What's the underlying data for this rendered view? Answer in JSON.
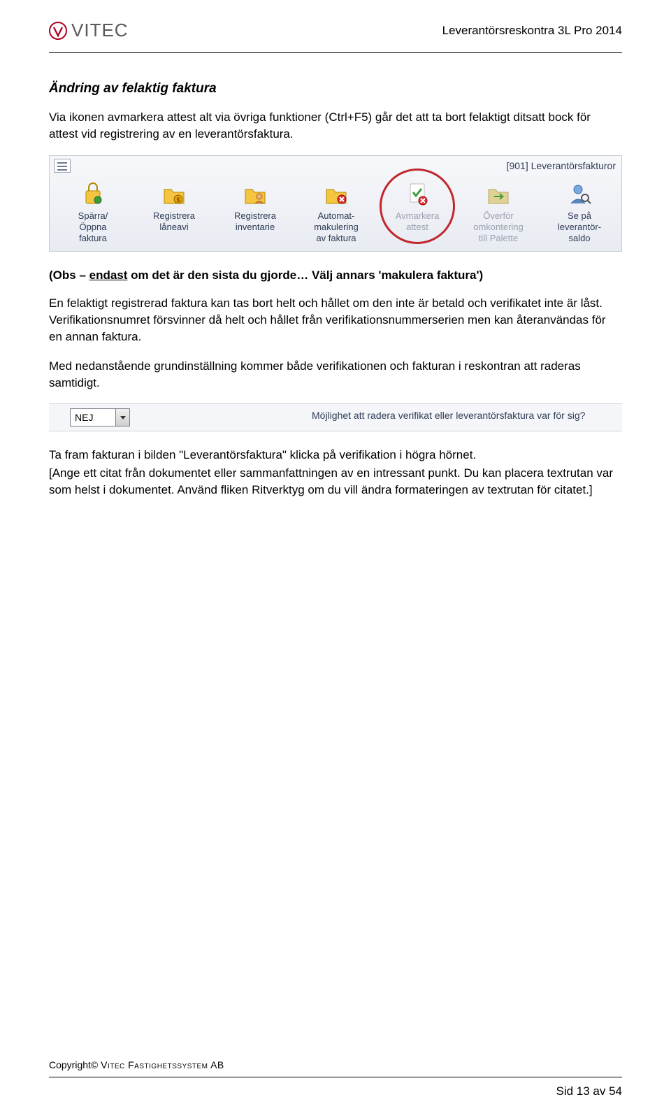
{
  "header": {
    "brand": "VITEC",
    "doc_title": "Leverantörsreskontra 3L Pro 2014"
  },
  "section_title": "Ändring av felaktig faktura",
  "para1": "Via ikonen avmarkera attest alt via övriga funktioner (Ctrl+F5) går det att ta bort felaktigt ditsatt bock för attest vid registrering av en leverantörsfaktura.",
  "toolbar": {
    "window_title": "[901]  Leverantörsfakturor",
    "items": [
      {
        "name": "lock-icon",
        "label_l1": "Spärra/",
        "label_l2": "Öppna",
        "label_l3": "faktura"
      },
      {
        "name": "register-loan-icon",
        "label_l1": "Registrera",
        "label_l2": "låneavi",
        "label_l3": ""
      },
      {
        "name": "register-inv-icon",
        "label_l1": "Registrera",
        "label_l2": "inventarie",
        "label_l3": ""
      },
      {
        "name": "auto-cancel-icon",
        "label_l1": "Automat-",
        "label_l2": "makulering",
        "label_l3": "av faktura"
      },
      {
        "name": "unmark-attest-icon",
        "label_l1": "Avmarkera",
        "label_l2": "attest",
        "label_l3": ""
      },
      {
        "name": "transfer-icon",
        "label_l1": "Överför",
        "label_l2": "omkontering",
        "label_l3": "till Palette"
      },
      {
        "name": "view-balance-icon",
        "label_l1": "Se på",
        "label_l2": "leverantör-",
        "label_l3": "saldo"
      }
    ]
  },
  "obs_prefix": "(Obs – ",
  "obs_underline": "endast",
  "obs_rest": " om det är den sista du gjorde… Välj annars 'makulera faktura')",
  "para2": "En felaktigt registrerad faktura kan tas bort helt och hållet om den inte är betald och verifikatet inte är låst. Verifikationsnumret försvinner då helt och hållet från verifikationsnummerserien men kan återanvändas för en annan faktura.",
  "para3": "Med nedanstående grundinställning kommer både verifikationen och fakturan i reskontran att raderas samtidigt.",
  "setting": {
    "value": "NEJ",
    "label": "Möjlighet att radera verifikat eller leverantörsfaktura var för sig?"
  },
  "para4": "Ta fram fakturan i bilden \"Leverantörsfaktura\" klicka på verifikation i högra hörnet.",
  "para5": "[Ange ett citat från dokumentet eller sammanfattningen av en intressant punkt. Du kan placera textrutan var som helst i dokumentet. Använd fliken Ritverktyg om du vill ändra formateringen av textrutan för citatet.]",
  "footer": {
    "copyright_prefix": "Copyright© ",
    "copyright_company": "Vitec Fastighetssystem AB",
    "page": "Sid 13 av 54"
  }
}
